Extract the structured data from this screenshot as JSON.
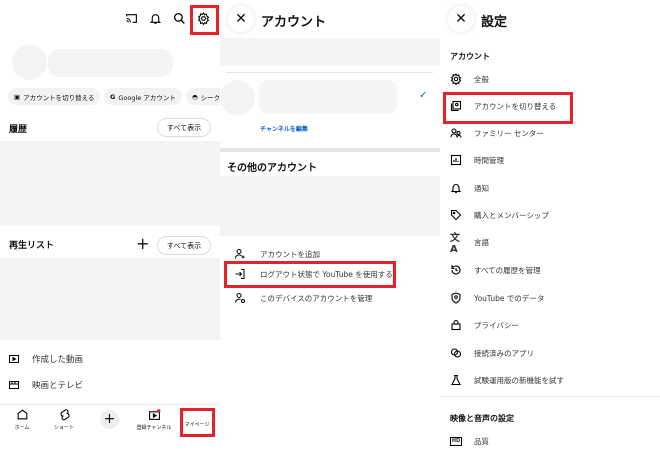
{
  "left": {
    "chips": [
      "アカウントを切り替える",
      "Google アカウント",
      "シークレット"
    ],
    "history_title": "履歴",
    "see_all": "すべて表示",
    "playlist_title": "再生リスト",
    "list": [
      "作成した動画",
      "映画とテレビ"
    ],
    "nav": [
      "ホーム",
      "ショート",
      "",
      "登録チャンネル",
      "マイページ"
    ]
  },
  "middle": {
    "title": "アカウント",
    "edit_channel": "チャンネルを編集",
    "other_accounts": "その他のアカウント",
    "items": [
      "アカウントを追加",
      "ログアウト状態で YouTube を使用する",
      "このデバイスのアカウントを管理"
    ]
  },
  "right": {
    "title": "設定",
    "section1": "アカウント",
    "items": [
      "全般",
      "アカウントを切り替える",
      "ファミリー センター",
      "時間管理",
      "通知",
      "購入とメンバーシップ",
      "言語",
      "すべての履歴を管理",
      "YouTube でのデータ",
      "プライバシー",
      "接続済みのアプリ",
      "試験運用版の新機能を試す"
    ],
    "section2": "映像と音声の設定",
    "quality": "品質"
  },
  "colors": {
    "highlight": "#e8202a",
    "link": "#065fd4"
  }
}
